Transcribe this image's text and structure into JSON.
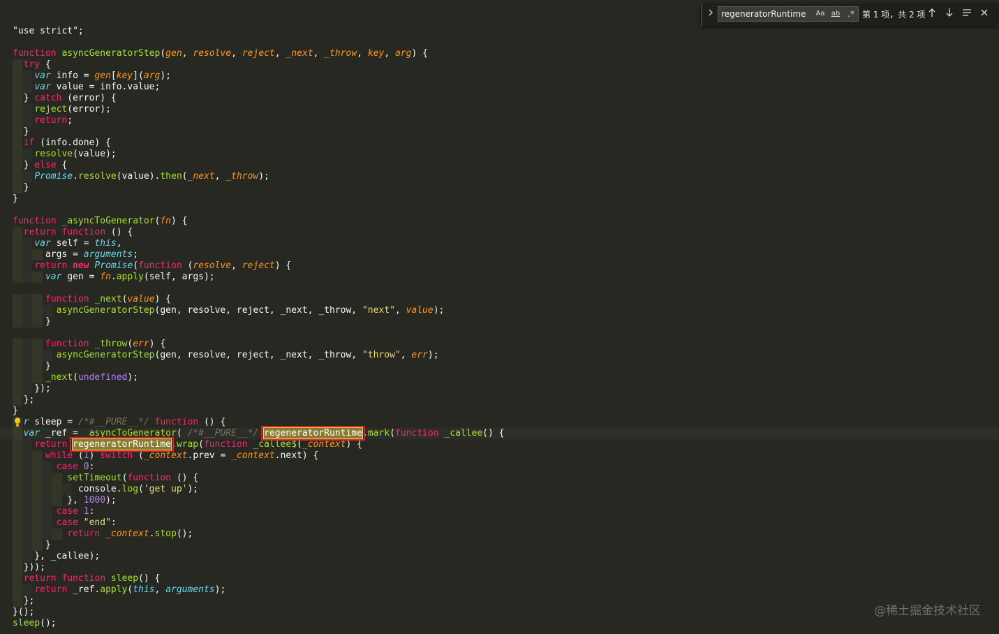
{
  "find_widget": {
    "query": "regeneratorRuntime",
    "match_case_label": "Aa",
    "whole_word_label": "ab",
    "regex_label": ".*",
    "count_text": "第 1 项，共 2 项",
    "expand_icon": "chevron-right-icon",
    "prev_icon": "arrow-up-icon",
    "next_icon": "arrow-down-icon",
    "selection_icon": "lines-icon",
    "close_icon": "close-icon"
  },
  "watermark": "@稀土掘金技术社区",
  "colors": {
    "background": "#272822",
    "keyword": "#f92672",
    "storage": "#66d9ef",
    "function_name": "#a6e22e",
    "parameter": "#fd971f",
    "string": "#e6db74",
    "number": "#ae81ff",
    "comment": "#75715e",
    "find_highlight_border": "#e0241b"
  },
  "code_lines": [
    [
      [
        "pn",
        "\"use strict\";"
      ]
    ],
    [],
    [
      [
        "kw",
        "function"
      ],
      [
        "pn",
        " "
      ],
      [
        "fn",
        "asyncGeneratorStep"
      ],
      [
        "pn",
        "("
      ],
      [
        "pr",
        "gen"
      ],
      [
        "pn",
        ", "
      ],
      [
        "pr",
        "resolve"
      ],
      [
        "pn",
        ", "
      ],
      [
        "pr",
        "reject"
      ],
      [
        "pn",
        ", "
      ],
      [
        "pr",
        "_next"
      ],
      [
        "pn",
        ", "
      ],
      [
        "pr",
        "_throw"
      ],
      [
        "pn",
        ", "
      ],
      [
        "pr",
        "key"
      ],
      [
        "pn",
        ", "
      ],
      [
        "pr",
        "arg"
      ],
      [
        "pn",
        ") {"
      ]
    ],
    [
      [
        "pn",
        "  "
      ],
      [
        "kw",
        "try"
      ],
      [
        "pn",
        " {"
      ]
    ],
    [
      [
        "pn",
        "    "
      ],
      [
        "st",
        "var"
      ],
      [
        "pn",
        " info = "
      ],
      [
        "prn",
        "gen"
      ],
      [
        "pn",
        "["
      ],
      [
        "prn",
        "key"
      ],
      [
        "pn",
        "]("
      ],
      [
        "prn",
        "arg"
      ],
      [
        "pn",
        ");"
      ]
    ],
    [
      [
        "pn",
        "    "
      ],
      [
        "st",
        "var"
      ],
      [
        "pn",
        " value = info.value;"
      ]
    ],
    [
      [
        "pn",
        "  } "
      ],
      [
        "kw",
        "catch"
      ],
      [
        "pn",
        " (error) {"
      ]
    ],
    [
      [
        "pn",
        "    "
      ],
      [
        "fn",
        "reject"
      ],
      [
        "pn",
        "(error);"
      ]
    ],
    [
      [
        "pn",
        "    "
      ],
      [
        "kw",
        "return"
      ],
      [
        "pn",
        ";"
      ]
    ],
    [
      [
        "pn",
        "  }"
      ]
    ],
    [
      [
        "pn",
        "  "
      ],
      [
        "kw",
        "if"
      ],
      [
        "pn",
        " (info.done) {"
      ]
    ],
    [
      [
        "pn",
        "    "
      ],
      [
        "fn",
        "resolve"
      ],
      [
        "pn",
        "(value);"
      ]
    ],
    [
      [
        "pn",
        "  } "
      ],
      [
        "kw",
        "else"
      ],
      [
        "pn",
        " {"
      ]
    ],
    [
      [
        "pn",
        "    "
      ],
      [
        "sti",
        "Promise"
      ],
      [
        "pn",
        "."
      ],
      [
        "fn",
        "resolve"
      ],
      [
        "pn",
        "(value)."
      ],
      [
        "fn",
        "then"
      ],
      [
        "pn",
        "("
      ],
      [
        "prn",
        "_next"
      ],
      [
        "pn",
        ", "
      ],
      [
        "prn",
        "_throw"
      ],
      [
        "pn",
        ");"
      ]
    ],
    [
      [
        "pn",
        "  }"
      ]
    ],
    [
      [
        "pn",
        "}"
      ]
    ],
    [],
    [
      [
        "kw",
        "function"
      ],
      [
        "pn",
        " "
      ],
      [
        "fn",
        "_asyncToGenerator"
      ],
      [
        "pn",
        "("
      ],
      [
        "pr",
        "fn"
      ],
      [
        "pn",
        ") {"
      ]
    ],
    [
      [
        "pn",
        "  "
      ],
      [
        "kw",
        "return"
      ],
      [
        "pn",
        " "
      ],
      [
        "kw",
        "function"
      ],
      [
        "pn",
        " () {"
      ]
    ],
    [
      [
        "pn",
        "    "
      ],
      [
        "st",
        "var"
      ],
      [
        "pn",
        " self = "
      ],
      [
        "sti",
        "this"
      ],
      [
        "pn",
        ","
      ]
    ],
    [
      [
        "pn",
        "      args = "
      ],
      [
        "sti",
        "arguments"
      ],
      [
        "pn",
        ";"
      ]
    ],
    [
      [
        "pn",
        "    "
      ],
      [
        "kw",
        "return"
      ],
      [
        "pn",
        " "
      ],
      [
        "kwb",
        "new"
      ],
      [
        "pn",
        " "
      ],
      [
        "sti",
        "Promise"
      ],
      [
        "pn",
        "("
      ],
      [
        "kw",
        "function"
      ],
      [
        "pn",
        " ("
      ],
      [
        "pr",
        "resolve"
      ],
      [
        "pn",
        ", "
      ],
      [
        "pr",
        "reject"
      ],
      [
        "pn",
        ") {"
      ]
    ],
    [
      [
        "pn",
        "      "
      ],
      [
        "st",
        "var"
      ],
      [
        "pn",
        " gen = "
      ],
      [
        "prn",
        "fn"
      ],
      [
        "pn",
        "."
      ],
      [
        "fn",
        "apply"
      ],
      [
        "pn",
        "(self, args);"
      ]
    ],
    [],
    [
      [
        "pn",
        "      "
      ],
      [
        "kw",
        "function"
      ],
      [
        "pn",
        " "
      ],
      [
        "fn",
        "_next"
      ],
      [
        "pn",
        "("
      ],
      [
        "pr",
        "value"
      ],
      [
        "pn",
        ") {"
      ]
    ],
    [
      [
        "pn",
        "        "
      ],
      [
        "fn",
        "asyncGeneratorStep"
      ],
      [
        "pn",
        "(gen, resolve, reject, _next, _throw, "
      ],
      [
        "str",
        "\"next\""
      ],
      [
        "pn",
        ", "
      ],
      [
        "pr",
        "value"
      ],
      [
        "pn",
        ");"
      ]
    ],
    [
      [
        "pn",
        "      }"
      ]
    ],
    [],
    [
      [
        "pn",
        "      "
      ],
      [
        "kw",
        "function"
      ],
      [
        "pn",
        " "
      ],
      [
        "fn",
        "_throw"
      ],
      [
        "pn",
        "("
      ],
      [
        "pr",
        "err"
      ],
      [
        "pn",
        ") {"
      ]
    ],
    [
      [
        "pn",
        "        "
      ],
      [
        "fn",
        "asyncGeneratorStep"
      ],
      [
        "pn",
        "(gen, resolve, reject, _next, _throw, "
      ],
      [
        "str",
        "\"throw\""
      ],
      [
        "pn",
        ", "
      ],
      [
        "pr",
        "err"
      ],
      [
        "pn",
        ");"
      ]
    ],
    [
      [
        "pn",
        "      }"
      ]
    ],
    [
      [
        "pn",
        "      "
      ],
      [
        "fn",
        "_next"
      ],
      [
        "pn",
        "("
      ],
      [
        "num",
        "undefined"
      ],
      [
        "pn",
        ");"
      ]
    ],
    [
      [
        "pn",
        "    });"
      ]
    ],
    [
      [
        "pn",
        "  };"
      ]
    ],
    [
      [
        "pn",
        "}"
      ]
    ],
    [
      [
        "pn",
        "  "
      ],
      [
        "st",
        "r"
      ],
      [
        "pn",
        " sleep = "
      ],
      [
        "com",
        "/*#__PURE__*/"
      ],
      [
        "pn",
        " "
      ],
      [
        "kw",
        "function"
      ],
      [
        "pn",
        " () {"
      ]
    ],
    [
      [
        "pn",
        "  "
      ],
      [
        "st",
        "var"
      ],
      [
        "pn",
        " _ref = "
      ],
      [
        "fn",
        "_asyncToGenerator"
      ],
      [
        "pn",
        "( "
      ],
      [
        "com",
        "/*#__PURE__*/"
      ],
      [
        "pn",
        " "
      ],
      [
        "match",
        "regeneratorRuntime"
      ],
      [
        "pn",
        "."
      ],
      [
        "fn",
        "mark"
      ],
      [
        "pn",
        "("
      ],
      [
        "kw",
        "function"
      ],
      [
        "pn",
        " "
      ],
      [
        "fn",
        "_callee"
      ],
      [
        "pn",
        "() {"
      ]
    ],
    [
      [
        "pn",
        "    "
      ],
      [
        "kw",
        "return"
      ],
      [
        "pn",
        " "
      ],
      [
        "match",
        "regeneratorRuntime"
      ],
      [
        "pn",
        "."
      ],
      [
        "fn",
        "wrap"
      ],
      [
        "pn",
        "("
      ],
      [
        "kw",
        "function"
      ],
      [
        "pn",
        " "
      ],
      [
        "fn",
        "_callee$"
      ],
      [
        "pn",
        "("
      ],
      [
        "pr",
        "_context"
      ],
      [
        "pn",
        ") {"
      ]
    ],
    [
      [
        "pn",
        "      "
      ],
      [
        "kw",
        "while"
      ],
      [
        "pn",
        " ("
      ],
      [
        "num",
        "1"
      ],
      [
        "pn",
        ") "
      ],
      [
        "kw",
        "switch"
      ],
      [
        "pn",
        " ("
      ],
      [
        "prn",
        "_context"
      ],
      [
        "pn",
        ".prev = "
      ],
      [
        "prn",
        "_context"
      ],
      [
        "pn",
        ".next) {"
      ]
    ],
    [
      [
        "pn",
        "        "
      ],
      [
        "kw",
        "case"
      ],
      [
        "pn",
        " "
      ],
      [
        "num",
        "0"
      ],
      [
        "pn",
        ":"
      ]
    ],
    [
      [
        "pn",
        "          "
      ],
      [
        "fn",
        "setTimeout"
      ],
      [
        "pn",
        "("
      ],
      [
        "kw",
        "function"
      ],
      [
        "pn",
        " () {"
      ]
    ],
    [
      [
        "pn",
        "            console."
      ],
      [
        "fn",
        "log"
      ],
      [
        "pn",
        "("
      ],
      [
        "str",
        "'get up'"
      ],
      [
        "pn",
        ");"
      ]
    ],
    [
      [
        "pn",
        "          }, "
      ],
      [
        "num",
        "1000"
      ],
      [
        "pn",
        ");"
      ]
    ],
    [
      [
        "pn",
        "        "
      ],
      [
        "kw",
        "case"
      ],
      [
        "pn",
        " "
      ],
      [
        "num",
        "1"
      ],
      [
        "pn",
        ":"
      ]
    ],
    [
      [
        "pn",
        "        "
      ],
      [
        "kw",
        "case"
      ],
      [
        "pn",
        " "
      ],
      [
        "str",
        "\"end\""
      ],
      [
        "pn",
        ":"
      ]
    ],
    [
      [
        "pn",
        "          "
      ],
      [
        "kw",
        "return"
      ],
      [
        "pn",
        " "
      ],
      [
        "prn",
        "_context"
      ],
      [
        "pn",
        "."
      ],
      [
        "fn",
        "stop"
      ],
      [
        "pn",
        "();"
      ]
    ],
    [
      [
        "pn",
        "      }"
      ]
    ],
    [
      [
        "pn",
        "    }, _callee);"
      ]
    ],
    [
      [
        "pn",
        "  }));"
      ]
    ],
    [
      [
        "pn",
        "  "
      ],
      [
        "kw",
        "return"
      ],
      [
        "pn",
        " "
      ],
      [
        "kw",
        "function"
      ],
      [
        "pn",
        " "
      ],
      [
        "fn",
        "sleep"
      ],
      [
        "pn",
        "() {"
      ]
    ],
    [
      [
        "pn",
        "    "
      ],
      [
        "kw",
        "return"
      ],
      [
        "pn",
        " _ref."
      ],
      [
        "fn",
        "apply"
      ],
      [
        "pn",
        "("
      ],
      [
        "sti",
        "this"
      ],
      [
        "pn",
        ", "
      ],
      [
        "sti",
        "arguments"
      ],
      [
        "pn",
        ");"
      ]
    ],
    [
      [
        "pn",
        "  };"
      ]
    ],
    [
      [
        "pn",
        "}();"
      ]
    ],
    [
      [
        "fn",
        "sleep"
      ],
      [
        "pn",
        "();"
      ]
    ]
  ]
}
